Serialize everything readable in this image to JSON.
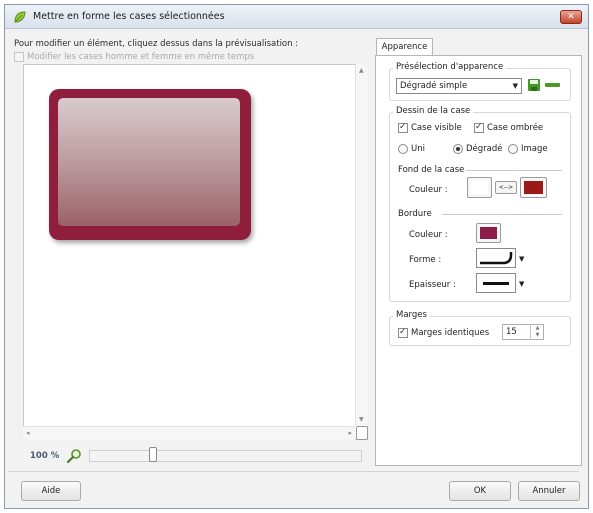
{
  "window": {
    "title": "Mettre en forme les cases sélectionnées",
    "close_glyph": "✕"
  },
  "left": {
    "instruction": "Pour modifier un élément, cliquez dessus dans la prévisualisation :",
    "sync_checkbox_label": "Modifier les cases homme et femme en même temps",
    "zoom_label": "100 %"
  },
  "tab": {
    "label": "Apparence"
  },
  "preset": {
    "group_label": "Présélection d'apparence",
    "selected_value": "Dégradé simple"
  },
  "cell_drawing": {
    "group_label": "Dessin de la case",
    "visible_label": "Case visible",
    "shadow_label": "Case ombrée",
    "radio_plain": "Uni",
    "radio_gradient": "Dégradé",
    "radio_image": "Image",
    "background_label": "Fond de la case",
    "color_label": "Couleur :",
    "swap_label": "<-->",
    "border_label": "Bordure",
    "border_color_label": "Couleur :",
    "shape_label": "Forme :",
    "thickness_label": "Epaisseur :"
  },
  "margins": {
    "group_label": "Marges",
    "identical_label": "Marges identiques",
    "value": "15"
  },
  "buttons": {
    "help": "Aide",
    "ok": "OK",
    "cancel": "Annuler"
  },
  "colors": {
    "gradient_start": "#ffffff",
    "gradient_end": "#9a1a1a",
    "border_color": "#8f1d4a",
    "preview_cell_border": "#8f1d3c"
  },
  "icons": {
    "title": "leaf-icon",
    "save": "save-disk-icon",
    "delete": "minus-icon",
    "zoom": "magnifier-icon"
  }
}
